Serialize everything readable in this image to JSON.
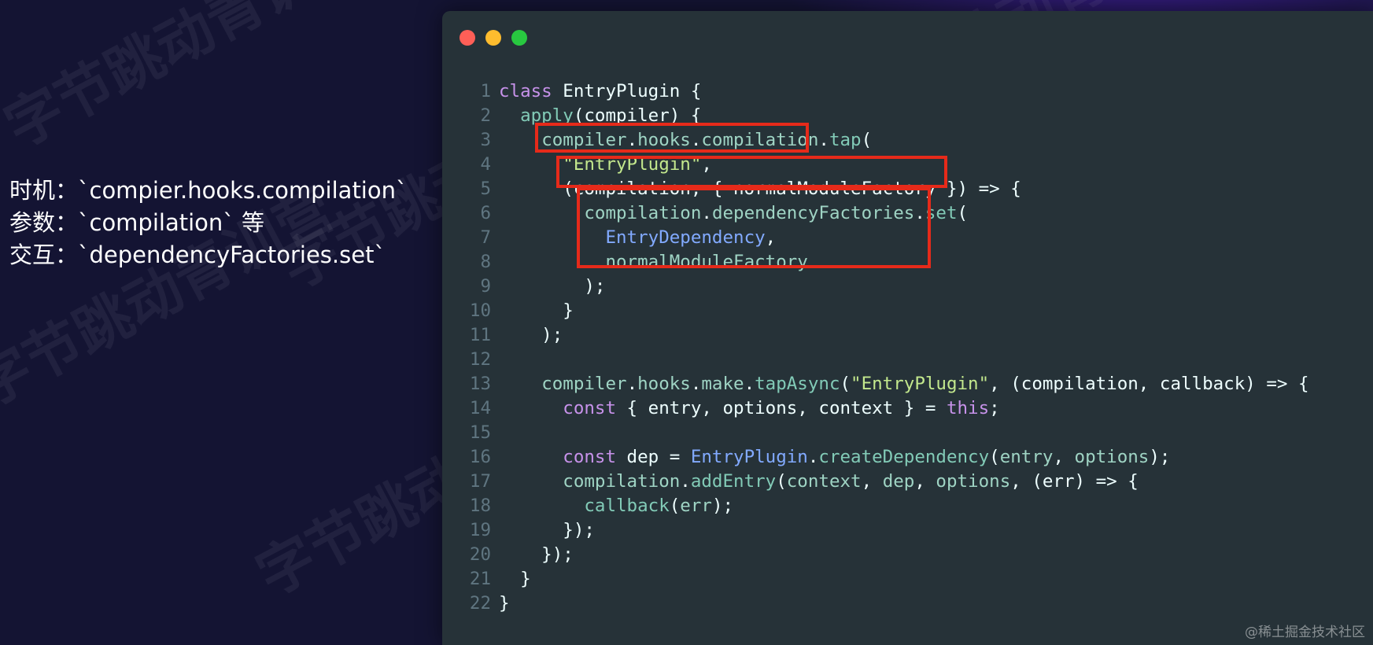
{
  "watermark_text": "字节跳动青训营",
  "notes": {
    "timing": "时机：`compier.hooks.compilation`",
    "params": "参数：`compilation` 等",
    "interaction": "交互：`dependencyFactories.set`"
  },
  "window_controls": [
    "close-dot",
    "minimize-dot",
    "maximize-dot"
  ],
  "code_lines": [
    {
      "n": "1",
      "tokens": [
        {
          "t": "class",
          "c": "kw"
        },
        {
          "t": " EntryPlugin {",
          "c": "pl"
        }
      ]
    },
    {
      "n": "2",
      "tokens": [
        {
          "t": "  ",
          "c": "pl"
        },
        {
          "t": "apply",
          "c": "fn"
        },
        {
          "t": "(compiler) {",
          "c": "pl"
        }
      ]
    },
    {
      "n": "3",
      "tokens": [
        {
          "t": "    ",
          "c": "pl"
        },
        {
          "t": "compiler",
          "c": "var"
        },
        {
          "t": ".",
          "c": "pl"
        },
        {
          "t": "hooks",
          "c": "var"
        },
        {
          "t": ".",
          "c": "pl"
        },
        {
          "t": "compilation",
          "c": "var"
        },
        {
          "t": ".",
          "c": "pl"
        },
        {
          "t": "tap",
          "c": "fn"
        },
        {
          "t": "(",
          "c": "pl"
        }
      ]
    },
    {
      "n": "4",
      "tokens": [
        {
          "t": "      ",
          "c": "pl"
        },
        {
          "t": "\"EntryPlugin\"",
          "c": "str"
        },
        {
          "t": ",",
          "c": "pl"
        }
      ]
    },
    {
      "n": "5",
      "tokens": [
        {
          "t": "      (compilation, { normalModuleFactory }) => {",
          "c": "pl"
        }
      ]
    },
    {
      "n": "6",
      "tokens": [
        {
          "t": "        ",
          "c": "pl"
        },
        {
          "t": "compilation",
          "c": "var"
        },
        {
          "t": ".",
          "c": "pl"
        },
        {
          "t": "dependencyFactories",
          "c": "var"
        },
        {
          "t": ".",
          "c": "pl"
        },
        {
          "t": "set",
          "c": "fn"
        },
        {
          "t": "(",
          "c": "pl"
        }
      ]
    },
    {
      "n": "7",
      "tokens": [
        {
          "t": "          ",
          "c": "pl"
        },
        {
          "t": "EntryDependency",
          "c": "cls"
        },
        {
          "t": ",",
          "c": "pl"
        }
      ]
    },
    {
      "n": "8",
      "tokens": [
        {
          "t": "          ",
          "c": "pl"
        },
        {
          "t": "normalModuleFactory",
          "c": "var"
        }
      ]
    },
    {
      "n": "9",
      "tokens": [
        {
          "t": "        );",
          "c": "pl"
        }
      ]
    },
    {
      "n": "10",
      "tokens": [
        {
          "t": "      }",
          "c": "pl"
        }
      ]
    },
    {
      "n": "11",
      "tokens": [
        {
          "t": "    );",
          "c": "pl"
        }
      ]
    },
    {
      "n": "12",
      "tokens": [
        {
          "t": "",
          "c": "pl"
        }
      ]
    },
    {
      "n": "13",
      "tokens": [
        {
          "t": "    ",
          "c": "pl"
        },
        {
          "t": "compiler",
          "c": "var"
        },
        {
          "t": ".",
          "c": "pl"
        },
        {
          "t": "hooks",
          "c": "var"
        },
        {
          "t": ".",
          "c": "pl"
        },
        {
          "t": "make",
          "c": "var"
        },
        {
          "t": ".",
          "c": "pl"
        },
        {
          "t": "tapAsync",
          "c": "fn"
        },
        {
          "t": "(",
          "c": "pl"
        },
        {
          "t": "\"EntryPlugin\"",
          "c": "str"
        },
        {
          "t": ", (compilation, callback) => {",
          "c": "pl"
        }
      ]
    },
    {
      "n": "14",
      "tokens": [
        {
          "t": "      ",
          "c": "pl"
        },
        {
          "t": "const",
          "c": "kw"
        },
        {
          "t": " { entry, options, context } = ",
          "c": "pl"
        },
        {
          "t": "this",
          "c": "kw"
        },
        {
          "t": ";",
          "c": "pl"
        }
      ]
    },
    {
      "n": "15",
      "tokens": [
        {
          "t": "",
          "c": "pl"
        }
      ]
    },
    {
      "n": "16",
      "tokens": [
        {
          "t": "      ",
          "c": "pl"
        },
        {
          "t": "const",
          "c": "kw"
        },
        {
          "t": " dep = ",
          "c": "pl"
        },
        {
          "t": "EntryPlugin",
          "c": "cls"
        },
        {
          "t": ".",
          "c": "pl"
        },
        {
          "t": "createDependency",
          "c": "fn"
        },
        {
          "t": "(",
          "c": "pl"
        },
        {
          "t": "entry",
          "c": "var"
        },
        {
          "t": ", ",
          "c": "pl"
        },
        {
          "t": "options",
          "c": "var"
        },
        {
          "t": ");",
          "c": "pl"
        }
      ]
    },
    {
      "n": "17",
      "tokens": [
        {
          "t": "      ",
          "c": "pl"
        },
        {
          "t": "compilation",
          "c": "var"
        },
        {
          "t": ".",
          "c": "pl"
        },
        {
          "t": "addEntry",
          "c": "fn"
        },
        {
          "t": "(",
          "c": "pl"
        },
        {
          "t": "context",
          "c": "var"
        },
        {
          "t": ", ",
          "c": "pl"
        },
        {
          "t": "dep",
          "c": "var"
        },
        {
          "t": ", ",
          "c": "pl"
        },
        {
          "t": "options",
          "c": "var"
        },
        {
          "t": ", (err) => {",
          "c": "pl"
        }
      ]
    },
    {
      "n": "18",
      "tokens": [
        {
          "t": "        ",
          "c": "pl"
        },
        {
          "t": "callback",
          "c": "fn"
        },
        {
          "t": "(",
          "c": "pl"
        },
        {
          "t": "err",
          "c": "var"
        },
        {
          "t": ");",
          "c": "pl"
        }
      ]
    },
    {
      "n": "19",
      "tokens": [
        {
          "t": "      });",
          "c": "pl"
        }
      ]
    },
    {
      "n": "20",
      "tokens": [
        {
          "t": "    });",
          "c": "pl"
        }
      ]
    },
    {
      "n": "21",
      "tokens": [
        {
          "t": "  }",
          "c": "pl"
        }
      ]
    },
    {
      "n": "22",
      "tokens": [
        {
          "t": "}",
          "c": "pl"
        }
      ]
    }
  ],
  "colors": {
    "editor_bg": "#263238",
    "keyword": "#c792ea",
    "function": "#82cbb7",
    "string": "#c3e88d",
    "class": "#82aaff",
    "highlight_box": "#e62a1a"
  },
  "credit": "@稀土掘金技术社区"
}
